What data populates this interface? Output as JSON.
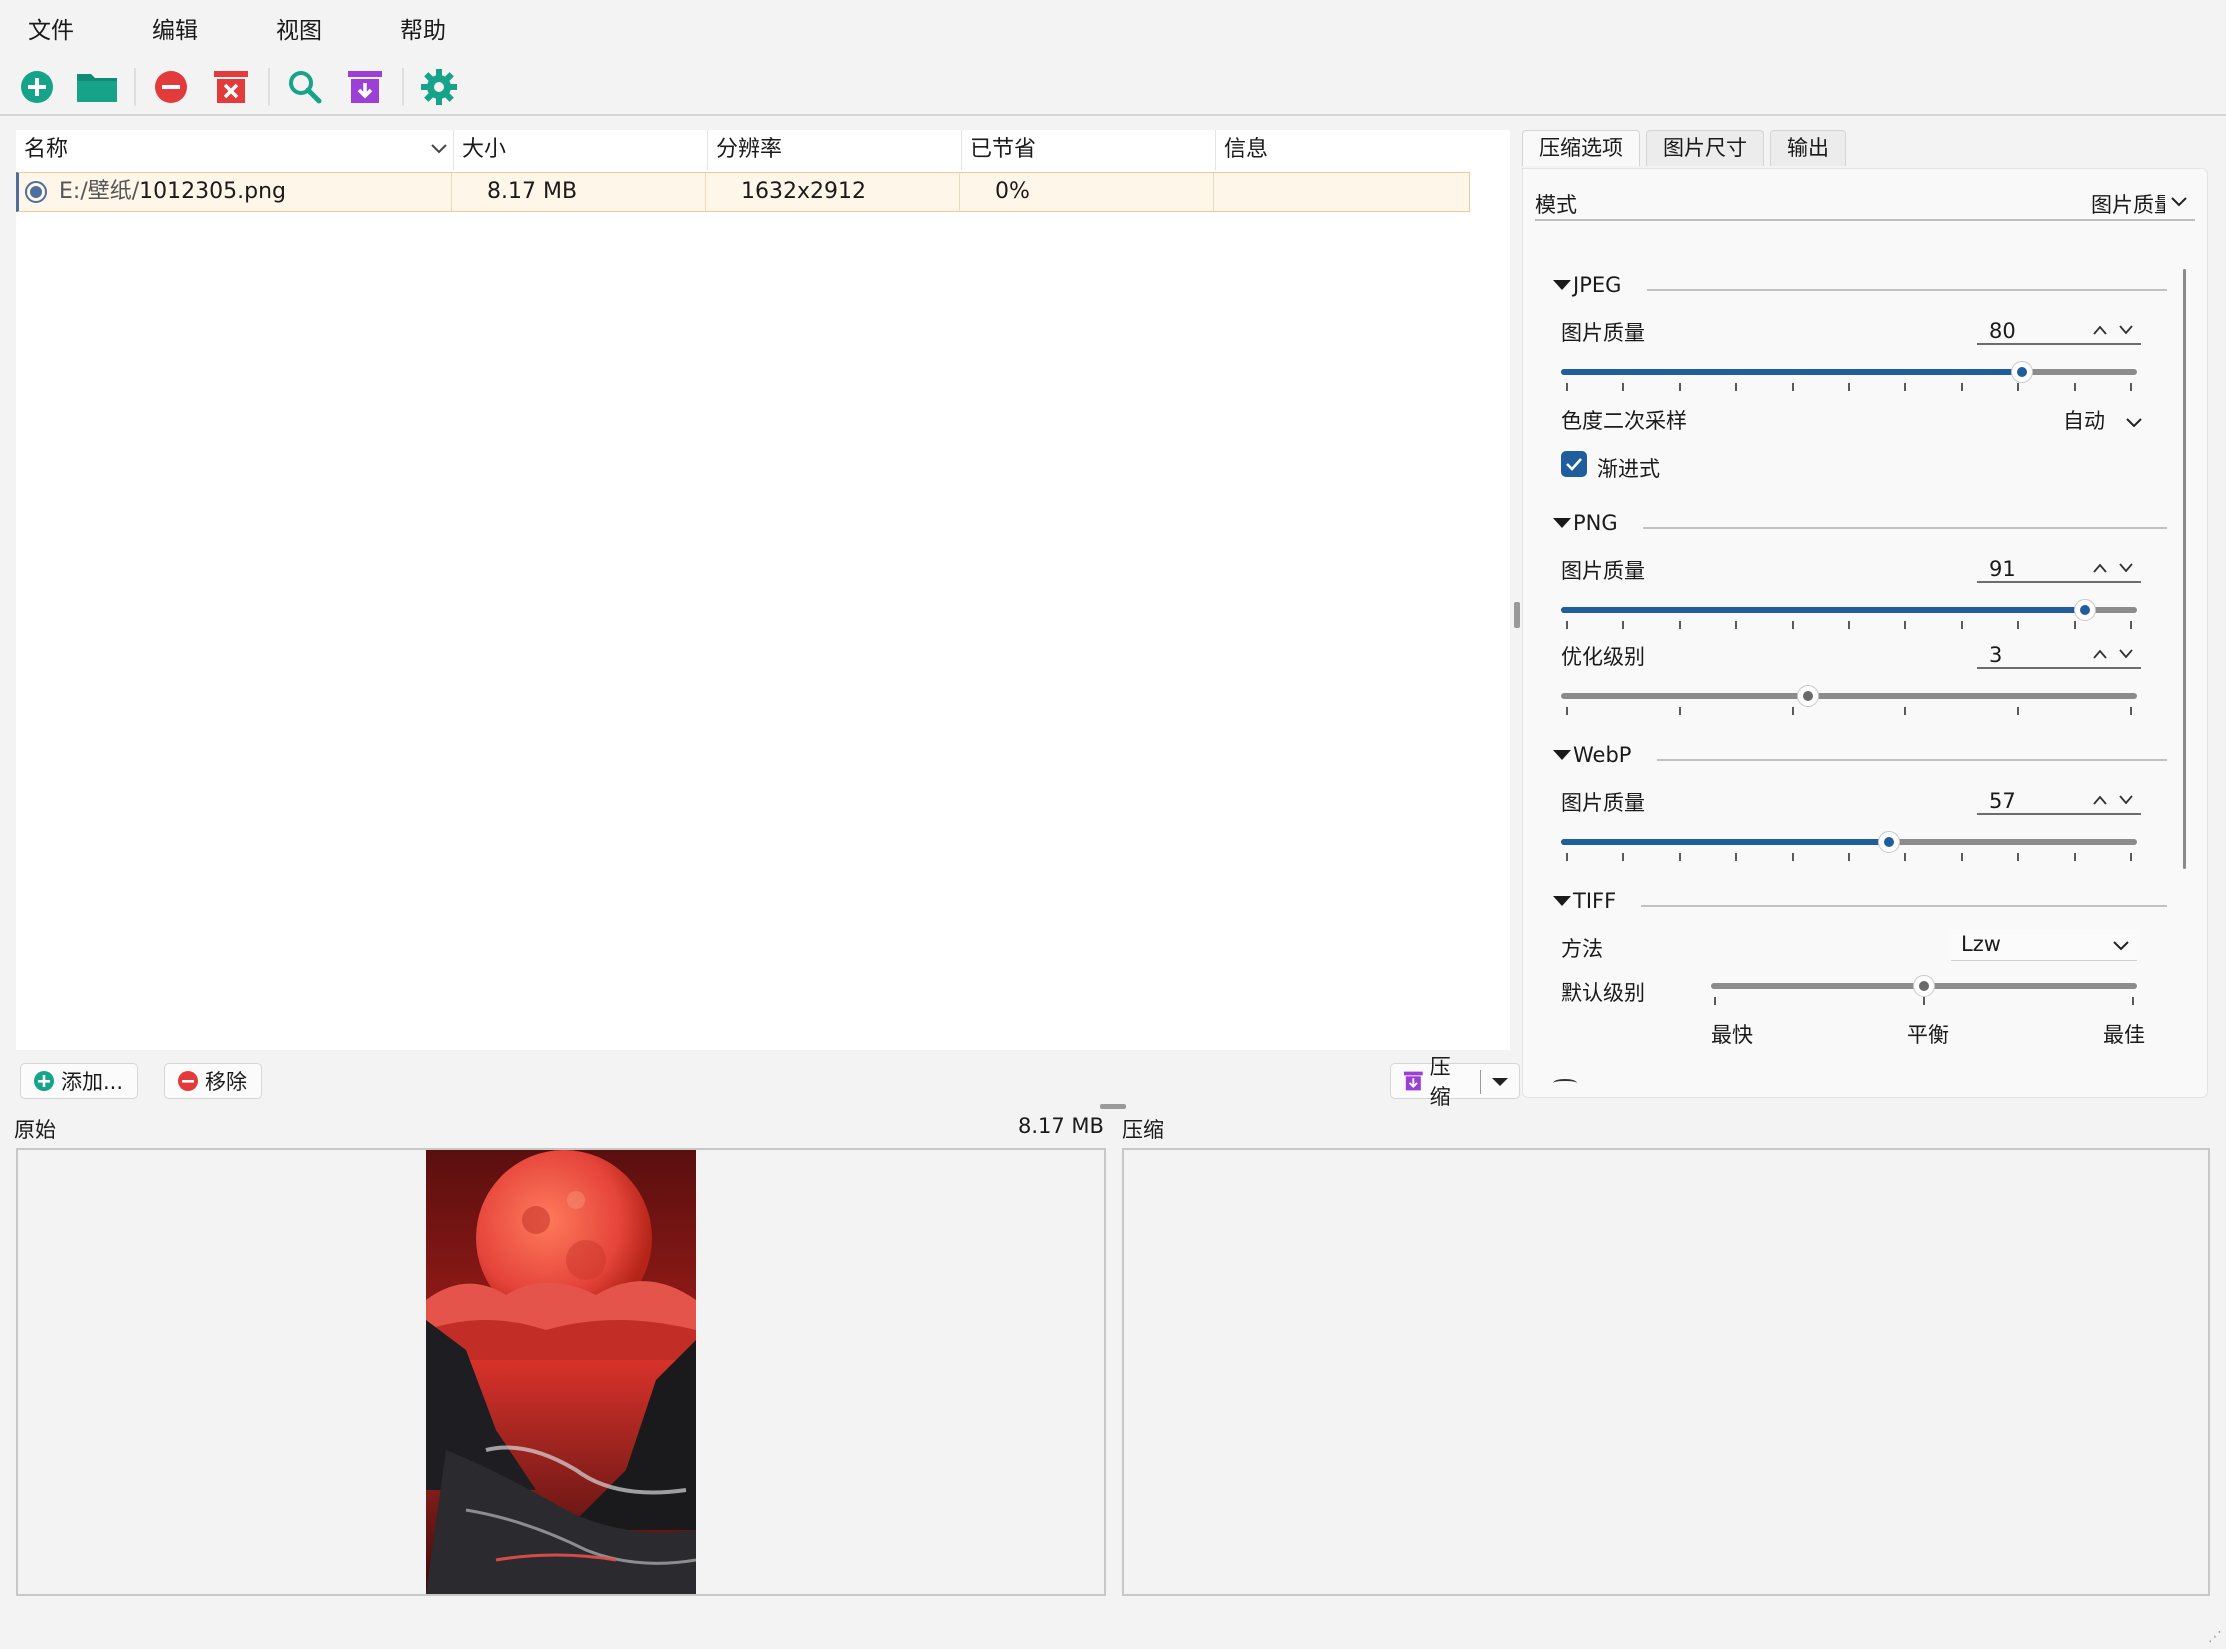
{
  "menu": [
    "文件",
    "编辑",
    "视图",
    "帮助"
  ],
  "toolbar": [
    {
      "name": "add-icon",
      "color": "#16a38a"
    },
    {
      "name": "open-folder-icon",
      "color": "#16a38a"
    },
    {
      "name": "remove-icon",
      "color": "#e33b3b"
    },
    {
      "name": "clear-list-icon",
      "color": "#e33b3b"
    },
    {
      "name": "preview-search-icon",
      "color": "#16a38a"
    },
    {
      "name": "compress-icon",
      "color": "#9b3fd6"
    },
    {
      "name": "settings-gear-icon",
      "color": "#16a38a"
    }
  ],
  "filelist": {
    "columns": [
      "名称",
      "大小",
      "分辨率",
      "已节省",
      "信息"
    ],
    "rows": [
      {
        "path_prefix": "E:/壁纸/",
        "filename": "1012305.png",
        "size": "8.17 MB",
        "resolution": "1632x2912",
        "saved": "0%",
        "info": ""
      }
    ]
  },
  "actions": {
    "add": "添加...",
    "remove": "移除",
    "compress": "压缩"
  },
  "tabs": [
    "压缩选项",
    "图片尺寸",
    "输出"
  ],
  "options": {
    "mode_label": "模式",
    "mode_value": "图片质量",
    "jpeg": {
      "title": "JPEG",
      "quality_label": "图片质量",
      "quality": 80,
      "subsampling_label": "色度二次采样",
      "subsampling": "自动",
      "progressive_label": "渐进式",
      "progressive": true
    },
    "png": {
      "title": "PNG",
      "quality_label": "图片质量",
      "quality": 91,
      "opt_label": "优化级别",
      "opt_level": 3
    },
    "webp": {
      "title": "WebP",
      "quality_label": "图片质量",
      "quality": 57
    },
    "tiff": {
      "title": "TIFF",
      "method_label": "方法",
      "method": "Lzw",
      "level_label": "默认级别",
      "level_ticks": [
        "最快",
        "平衡",
        "最佳"
      ],
      "level": 0.5
    }
  },
  "preview": {
    "original_label": "原始",
    "original_size": "8.17 MB",
    "compressed_label": "压缩"
  },
  "colors": {
    "accent": "#1f5d9c",
    "selection": "#fff6ea",
    "moon": "#e5443a"
  }
}
